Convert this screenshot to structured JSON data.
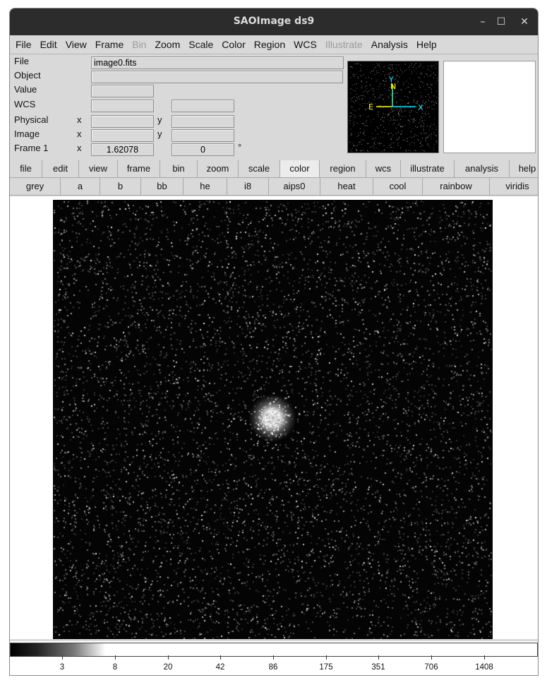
{
  "window": {
    "title": "SAOImage ds9"
  },
  "menubar": [
    "File",
    "Edit",
    "View",
    "Frame",
    "Bin",
    "Zoom",
    "Scale",
    "Color",
    "Region",
    "WCS",
    "Illustrate",
    "Analysis",
    "Help"
  ],
  "menubar_disabled": [
    "Bin",
    "Illustrate"
  ],
  "info": {
    "file_label": "File",
    "file_value": "image0.fits",
    "object_label": "Object",
    "object_value": "",
    "value_label": "Value",
    "value_value": "",
    "wcs_label": "WCS",
    "physical_label": "Physical",
    "image_label": "Image",
    "frame_label": "Frame 1",
    "frame_zoom": "1.62078",
    "frame_angle": "0",
    "degree_symbol": "°",
    "x_label": "x",
    "y_label": "y"
  },
  "panner": {
    "north": "N",
    "east": "E",
    "x": "X",
    "y": "Y"
  },
  "buttons_main": [
    "file",
    "edit",
    "view",
    "frame",
    "bin",
    "zoom",
    "scale",
    "color",
    "region",
    "wcs",
    "illustrate",
    "analysis",
    "help"
  ],
  "buttons_main_active": "color",
  "buttons_color": [
    "grey",
    "a",
    "b",
    "bb",
    "he",
    "i8",
    "aips0",
    "heat",
    "cool",
    "rainbow",
    "viridis"
  ],
  "colorbar": {
    "ticks": [
      "3",
      "8",
      "20",
      "42",
      "86",
      "175",
      "351",
      "706",
      "1408"
    ]
  }
}
